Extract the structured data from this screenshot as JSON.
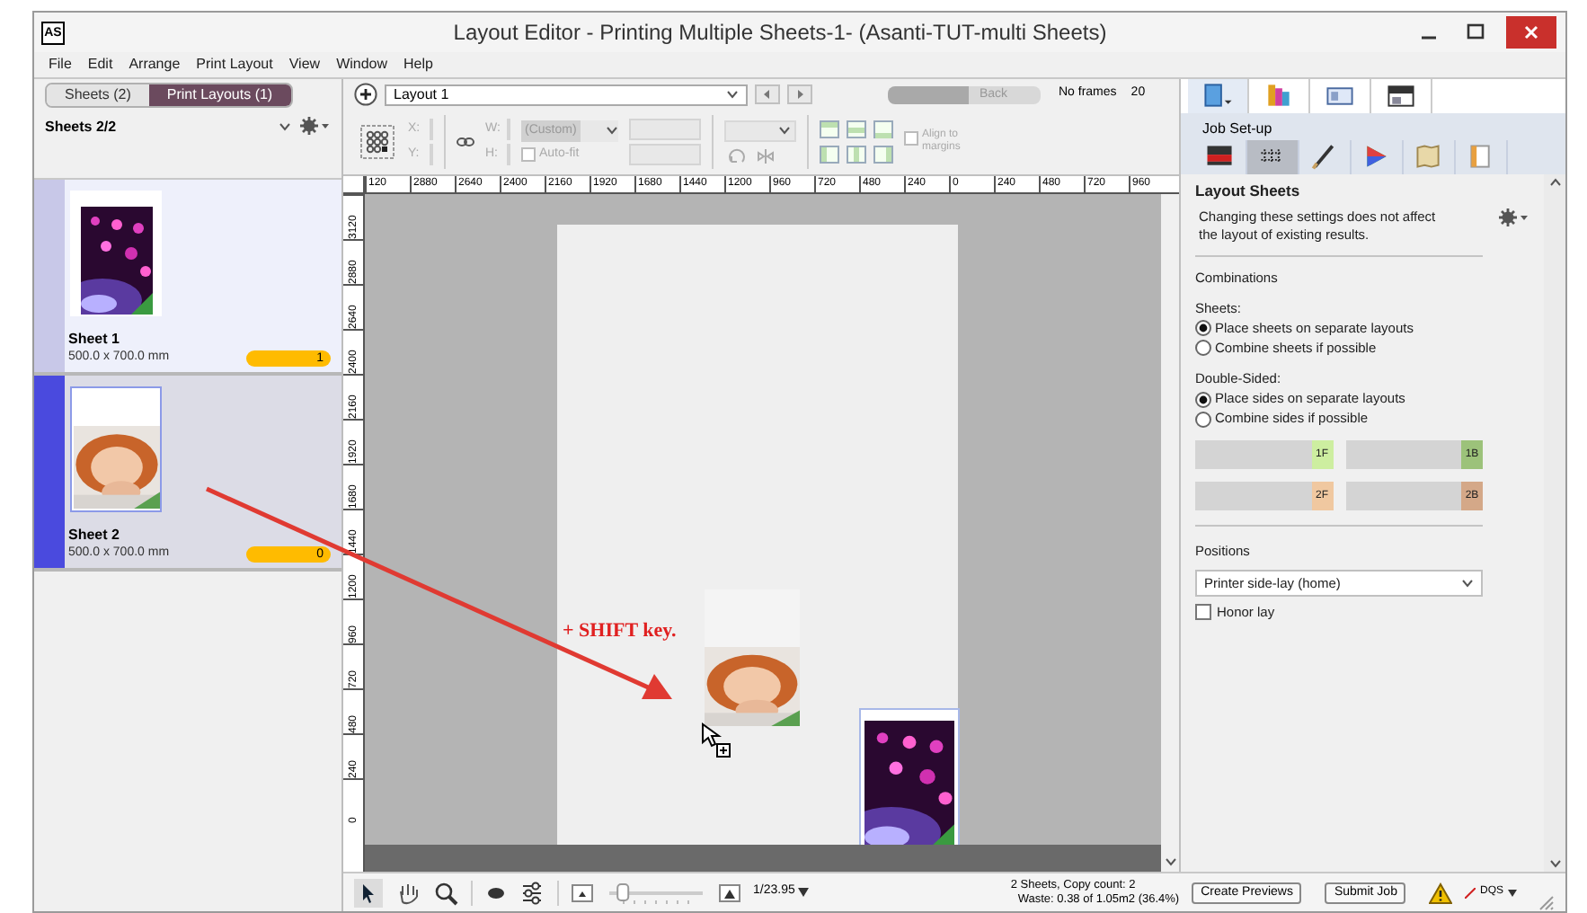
{
  "window": {
    "title": "Layout Editor - Printing Multiple Sheets-1- (Asanti-TUT-multi Sheets)",
    "logo": "AS"
  },
  "menu": [
    "File",
    "Edit",
    "Arrange",
    "Print Layout",
    "View",
    "Window",
    "Help"
  ],
  "left_tabs": [
    {
      "label": "Sheets (2)",
      "selected": false
    },
    {
      "label": "Print Layouts (1)",
      "selected": true
    }
  ],
  "sheets_header": "Sheets 2/2",
  "sheets": [
    {
      "name": "Sheet 1",
      "size": "500.0 x 700.0 mm",
      "count": "1",
      "selected": false
    },
    {
      "name": "Sheet 2",
      "size": "500.0 x 700.0 mm",
      "count": "0",
      "selected": true
    }
  ],
  "layout_toolbar": {
    "layout": "Layout 1",
    "side_label": "Back",
    "frames": "No frames",
    "cut_value": "20"
  },
  "transform": {
    "x_label": "X:",
    "y_label": "Y:",
    "w_label": "W:",
    "h_label": "H:",
    "preset": "(Custom)",
    "auto_fit": {
      "label": "Auto-fit",
      "checked": false
    },
    "align": {
      "lines": [
        "Align to",
        "margins"
      ],
      "checked": false
    }
  },
  "ruler_h": [
    "120",
    "2880",
    "2640",
    "2400",
    "2160",
    "1920",
    "1680",
    "1440",
    "1200",
    "960",
    "720",
    "480",
    "240",
    "0",
    "240",
    "480",
    "720",
    "960"
  ],
  "ruler_v": [
    "3120",
    "2880",
    "2640",
    "2400",
    "2160",
    "1920",
    "1680",
    "1440",
    "1200",
    "960",
    "720",
    "480",
    "240",
    "0"
  ],
  "annotation": "+ SHIFT key.",
  "right_tabs": [
    {
      "selected": true
    },
    {
      "selected": false
    },
    {
      "selected": false
    },
    {
      "selected": false
    }
  ],
  "job_setup": "Job Set-up",
  "setup_tabs": [
    {
      "selected": false
    },
    {
      "selected": true
    },
    {
      "selected": false
    },
    {
      "selected": false
    },
    {
      "selected": false
    },
    {
      "selected": false
    }
  ],
  "layout_sheets": {
    "title": "Layout Sheets",
    "note": "Changing these settings does not affect the layout of existing results.",
    "section": "Combinations",
    "groups": [
      {
        "label": "Sheets:",
        "options": [
          {
            "label": "Place sheets on separate layouts",
            "selected": true
          },
          {
            "label": "Combine sheets if possible",
            "selected": false
          }
        ]
      },
      {
        "label": "Double-Sided:",
        "options": [
          {
            "label": "Place sides on separate layouts",
            "selected": true
          },
          {
            "label": "Combine sides if possible",
            "selected": false
          }
        ]
      }
    ],
    "chips": [
      {
        "label": "1F",
        "color": "#cdeea0"
      },
      {
        "label": "1B",
        "color": "#9cc27a"
      },
      {
        "label": "2F",
        "color": "#f0c8a0"
      },
      {
        "label": "2B",
        "color": "#d4a888"
      }
    ],
    "positions_label": "Positions",
    "positions": "Printer side-lay (home)",
    "honor_lay": {
      "label": "Honor lay",
      "checked": false
    }
  },
  "status": {
    "zoom_slider": {
      "level": 0.1
    },
    "zoom": "1/23.95",
    "summary": [
      "2 Sheets, Copy count: 2",
      "Waste: 0.38 of 1.05m2 (36.4%)"
    ],
    "buttons": [
      "Create Previews",
      "Submit Job"
    ],
    "profile": "DQS"
  }
}
